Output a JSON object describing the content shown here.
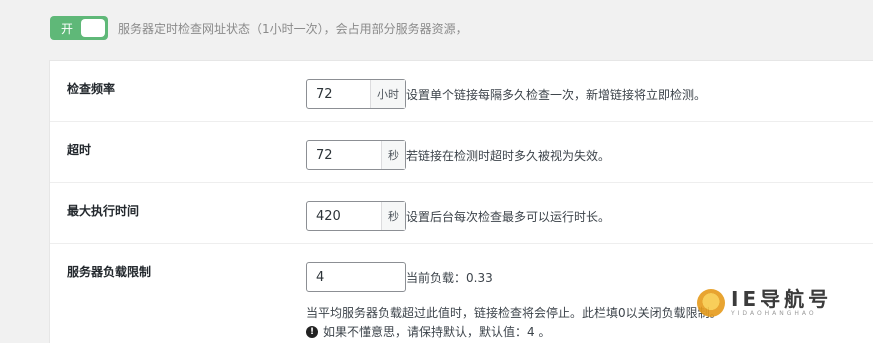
{
  "toggle": {
    "label": "开",
    "state": "on",
    "color": "#5fb878",
    "description": "服务器定时检查网址状态（1小时一次），会占用部分服务器资源，"
  },
  "settings": [
    {
      "label": "检查频率",
      "value": "72",
      "unit": "小时",
      "description": "设置单个链接每隔多久检查一次，新增链接将立即检测。"
    },
    {
      "label": "超时",
      "value": "72",
      "unit": "秒",
      "description": "若链接在检测时超时多久被视为失效。"
    },
    {
      "label": "最大执行时间",
      "value": "420",
      "unit": "秒",
      "description": "设置后台每次检查最多可以运行时长。"
    },
    {
      "label": "服务器负载限制",
      "value": "4",
      "unit": "",
      "description": "当前负载：0.33"
    }
  ],
  "load_note": "当平均服务器负载超过此值时，链接检查将会停止。此栏填0以关闭负载限制。",
  "load_hint": "如果不懂意思，请保持默认，默认值：4 。",
  "watermark": {
    "main": "IE导航号",
    "sub": "YIDAOHANGHAO"
  }
}
